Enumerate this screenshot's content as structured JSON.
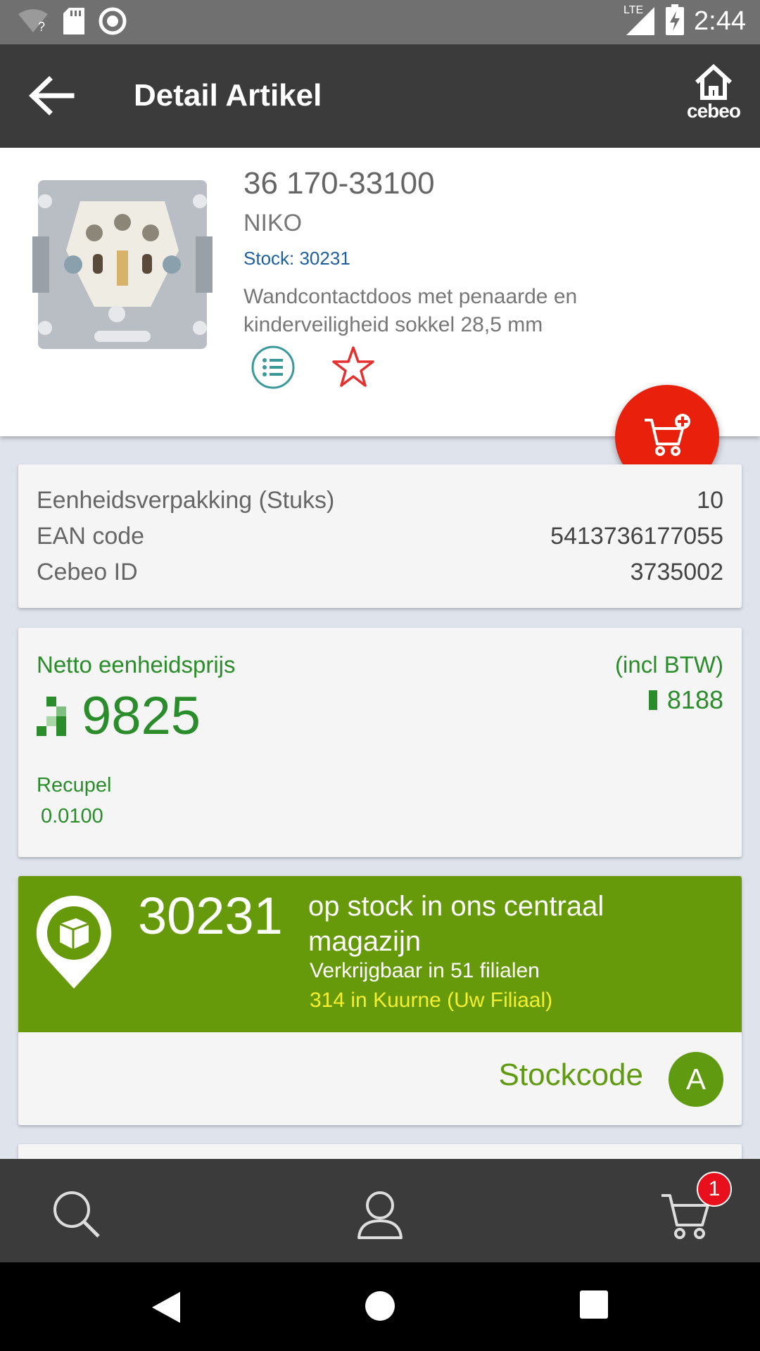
{
  "status_bar": {
    "time": "2:44",
    "network_label": "LTE",
    "icons": [
      "wifi-question-icon",
      "sd-card-icon",
      "circle-icon",
      "signal-icon",
      "battery-charging-icon"
    ]
  },
  "app_bar": {
    "title": "Detail Artikel",
    "home_logo_text": "cebeo"
  },
  "product": {
    "code": "36 170-33100",
    "brand": "NIKO",
    "stock": "Stock: 30231",
    "description": "Wandcontactdoos met penaarde en kinderveiligheid sokkel 28,5 mm"
  },
  "details": {
    "rows": [
      {
        "label": "Eenheidsverpakking (Stuks)",
        "value": "10"
      },
      {
        "label": "EAN code",
        "value": "5413736177055"
      },
      {
        "label": "Cebeo ID",
        "value": "3735002"
      }
    ]
  },
  "pricing": {
    "label": "Netto eenheidsprijs",
    "price": "9825",
    "incl_label": "(incl BTW)",
    "price_incl": "8188",
    "recupel_label": "Recupel",
    "recupel_value": "0.0100",
    "color": "#2a8c2a"
  },
  "stock_info": {
    "quantity": "30231",
    "line1": "op stock in ons centraal magazijn",
    "line2": "Verkrijgbaar in 51 filialen",
    "line3": "314 in Kuurne (Uw Filiaal)",
    "stockcode_label": "Stockcode",
    "stockcode_value": "A",
    "color": "#679a0a"
  },
  "bottom_nav": {
    "items": [
      "search-icon",
      "profile-icon",
      "cart-icon"
    ],
    "cart_badge": "1"
  },
  "accent_colors": {
    "fab": "#e8200c",
    "badge": "#e8101c"
  }
}
